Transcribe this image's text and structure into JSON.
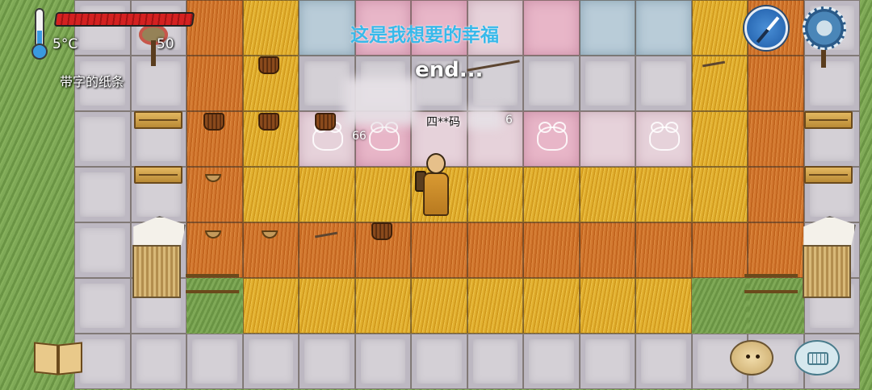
{
  "hud": {
    "temperature": "5°C",
    "food_value": "50",
    "held_item": "带字的纸条",
    "health_icon": "red-health-bar",
    "thermometer_icon": "thermometer-icon"
  },
  "chat": {
    "speech": "这是我想要的幸福",
    "end_text": "end..."
  },
  "player": {
    "name_tag": "四**码",
    "right_number": "6",
    "left_number": "66"
  },
  "controls": {
    "compass_icon": "compass-icon",
    "settings_icon": "settings-gear-icon",
    "book_icon": "open-book-icon",
    "emote_icon": "potato-emote-icon",
    "keyboard_icon": "keyboard-icon"
  },
  "colors": {
    "speech": "#38b9ea",
    "health": "#d42121",
    "temperature_fill": "#3a9ae0"
  }
}
